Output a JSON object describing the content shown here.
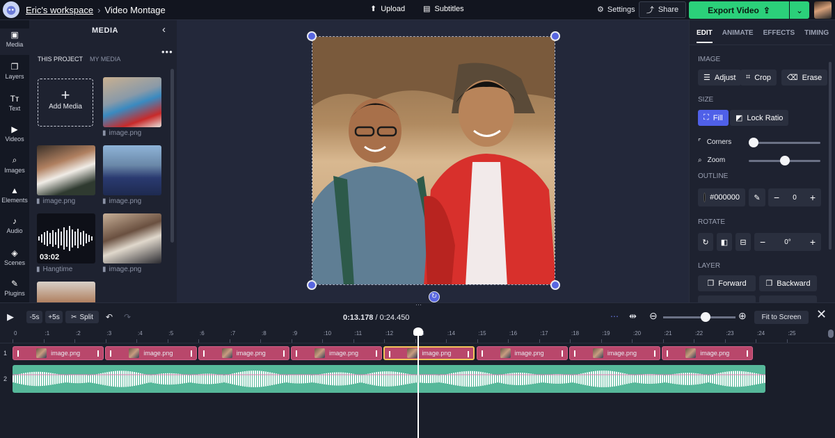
{
  "header": {
    "workspace": "Eric's workspace",
    "project": "Video Montage",
    "upload": "Upload",
    "subtitles": "Subtitles",
    "settings": "Settings",
    "share": "Share",
    "export": "Export Video"
  },
  "rail": [
    {
      "label": "Media",
      "icon": "media-icon"
    },
    {
      "label": "Layers",
      "icon": "layers-icon"
    },
    {
      "label": "Text",
      "icon": "text-icon"
    },
    {
      "label": "Videos",
      "icon": "videos-icon"
    },
    {
      "label": "Images",
      "icon": "images-icon"
    },
    {
      "label": "Elements",
      "icon": "elements-icon"
    },
    {
      "label": "Audio",
      "icon": "audio-icon"
    },
    {
      "label": "Scenes",
      "icon": "scenes-icon"
    },
    {
      "label": "Plugins",
      "icon": "plugins-icon"
    }
  ],
  "media": {
    "title": "MEDIA",
    "tab_project": "THIS PROJECT",
    "tab_mine": "MY MEDIA",
    "add_media": "Add Media",
    "items": [
      {
        "caption": "image.png"
      },
      {
        "caption": "image.png"
      },
      {
        "caption": "image.png"
      },
      {
        "caption": "Hangtime",
        "duration": "03:02"
      },
      {
        "caption": "image.png"
      }
    ]
  },
  "edit": {
    "tabs": [
      "EDIT",
      "ANIMATE",
      "EFFECTS",
      "TIMING"
    ],
    "image_label": "IMAGE",
    "adjust": "Adjust",
    "crop": "Crop",
    "erase": "Erase",
    "size_label": "SIZE",
    "fill": "Fill",
    "lock_ratio": "Lock Ratio",
    "corners": "Corners",
    "zoom": "Zoom",
    "corners_level": 0,
    "zoom_level": 0.5,
    "outline_label": "OUTLINE",
    "outline_color": "#000000",
    "outline_value": "0",
    "rotate_label": "ROTATE",
    "rotate_value": "0°",
    "layer_label": "LAYER",
    "forward": "Forward",
    "backward": "Backward"
  },
  "timeline": {
    "back5": "-5s",
    "fwd5": "+5s",
    "split": "Split",
    "current_time": "0:13.178",
    "total_time": "0:24.450",
    "fit": "Fit to Screen",
    "zoom_level": 0.6,
    "ticks": [
      "0",
      ":1",
      ":2",
      ":3",
      ":4",
      ":5",
      ":6",
      ":7",
      ":8",
      ":9",
      ":10",
      ":11",
      ":12",
      ":13",
      ":14",
      ":15",
      ":16",
      ":17",
      ":18",
      ":19",
      ":20",
      ":21",
      ":22",
      ":23",
      ":24",
      ":25"
    ],
    "track1": "1",
    "track2": "2",
    "clips": [
      "image.png",
      "image.png",
      "image.png",
      "image.png",
      "image.png",
      "image.png",
      "image.png",
      "image.png"
    ],
    "selected_clip": 4
  },
  "colors": {
    "accent": "#2bd07a",
    "primary": "#4f60e8",
    "clip": "#b9476b",
    "audio": "#56b89a"
  }
}
